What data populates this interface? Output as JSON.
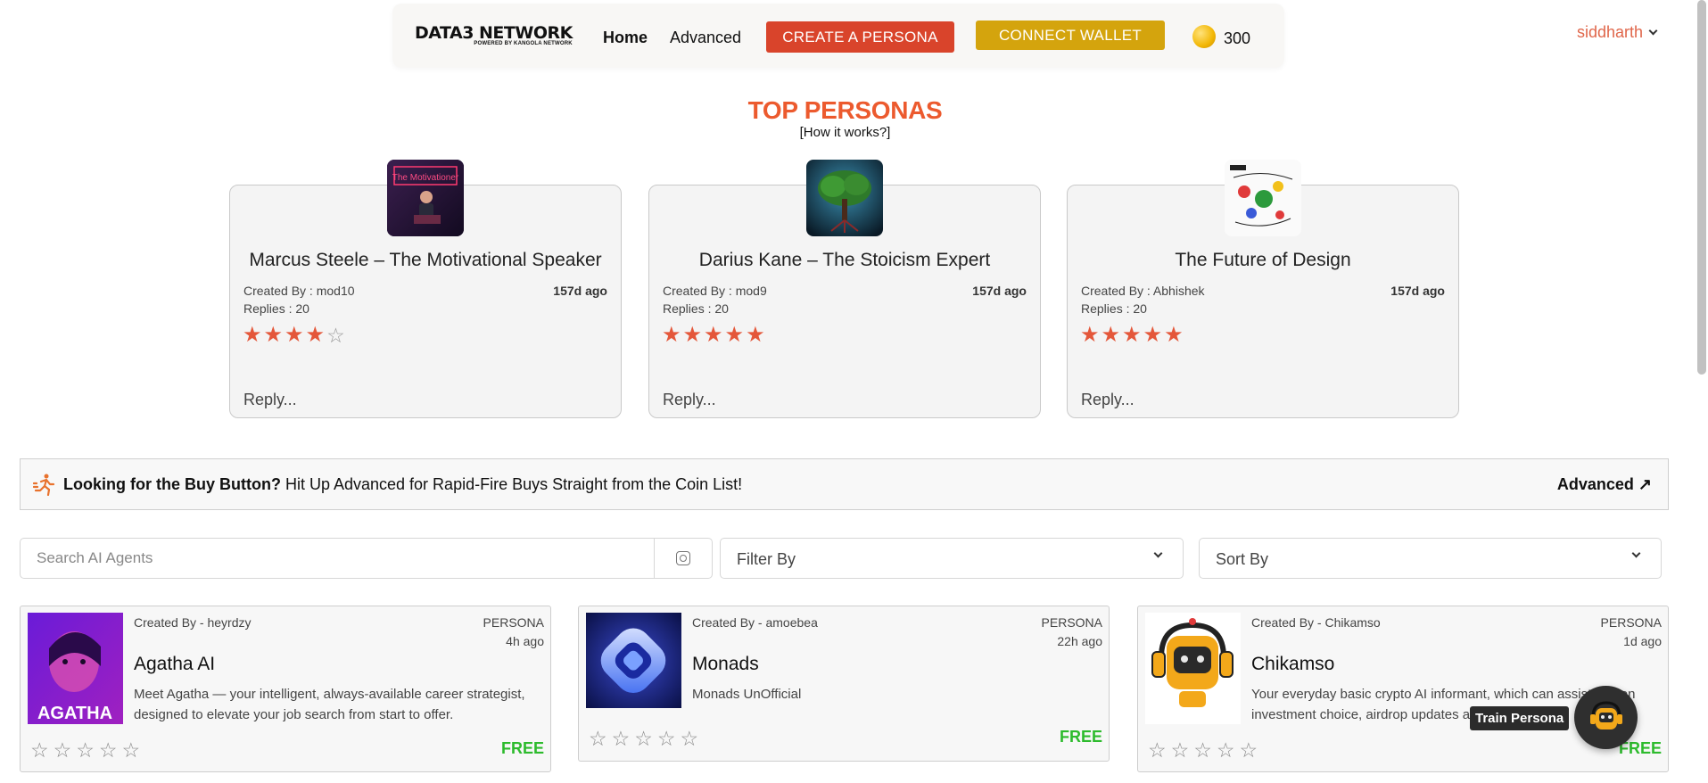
{
  "nav": {
    "logo_main": "DATA3 NETWORK",
    "logo_sub": "POWERED BY KANGOLA NETWORK",
    "home": "Home",
    "advanced": "Advanced",
    "create_persona": "CREATE A PERSONA",
    "connect_wallet": "CONNECT WALLET",
    "coin_balance": "300",
    "username": "siddharth"
  },
  "top": {
    "title": "TOP PERSONAS",
    "how": "[How it works?]",
    "cards": [
      {
        "name": "Marcus Steele – The Motivational Speaker",
        "created": "Created By : mod10",
        "ago": "157d ago",
        "replies": "Replies : 20",
        "rating": 4,
        "reply_placeholder": "Reply..."
      },
      {
        "name": "Darius Kane – The Stoicism Expert",
        "created": "Created By : mod9",
        "ago": "157d ago",
        "replies": "Replies : 20",
        "rating": 5,
        "reply_placeholder": "Reply..."
      },
      {
        "name": "The Future of Design",
        "created": "Created By : Abhishek",
        "ago": "157d ago",
        "replies": "Replies : 20",
        "rating": 5,
        "reply_placeholder": "Reply..."
      }
    ]
  },
  "banner": {
    "question": "Looking for the Buy Button?",
    "text": " Hit Up Advanced for Rapid-Fire Buys Straight from the Coin List!",
    "link": "Advanced ↗"
  },
  "search": {
    "placeholder": "Search AI Agents"
  },
  "filter": {
    "label": "Filter By"
  },
  "sort": {
    "label": "Sort By"
  },
  "agents": [
    {
      "by": "Created By - heyrdzy",
      "type": "PERSONA",
      "ago": "4h ago",
      "title": "Agatha AI",
      "desc": "Meet Agatha — your intelligent, always-available career strategist, designed to elevate your job search from start to offer.",
      "price": "FREE",
      "thumb_label": "AGATHA",
      "rating": 0
    },
    {
      "by": "Created By - amoebea",
      "type": "PERSONA",
      "ago": "22h ago",
      "title": "Monads",
      "desc": "Monads UnOfficial",
      "price": "FREE",
      "rating": 0
    },
    {
      "by": "Created By - Chikamso",
      "type": "PERSONA",
      "ago": "1d ago",
      "title": "Chikamso",
      "desc": "Your everyday basic crypto AI informant, which can assist you on investment choice, airdrop updates and much more.",
      "price": "FREE",
      "rating": 0
    }
  ],
  "train": {
    "tooltip": "Train Persona"
  },
  "thumb_text": {
    "motivation": "The Motivationer"
  },
  "colors": {
    "accent": "#ec5a2e",
    "create_btn": "#d9442b",
    "wallet_btn": "#d4a40d",
    "star": "#e4573a",
    "free": "#2dbb2d"
  }
}
